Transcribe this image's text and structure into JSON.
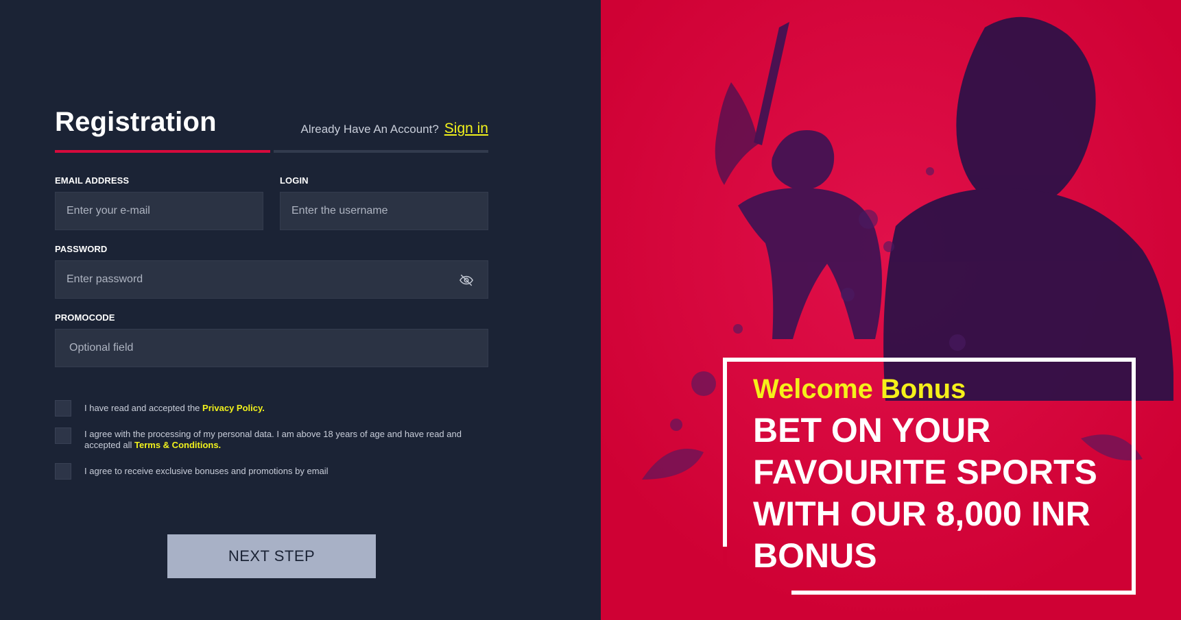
{
  "registration": {
    "title": "Registration",
    "already_text": "Already Have An Account?",
    "sign_in_label": "Sign in"
  },
  "form": {
    "email": {
      "label": "EMAIL ADDRESS",
      "placeholder": "Enter your e-mail"
    },
    "login": {
      "label": "LOGIN",
      "placeholder": "Enter the username"
    },
    "password": {
      "label": "PASSWORD",
      "placeholder": "Enter password"
    },
    "promocode": {
      "label": "PROMOCODE",
      "placeholder": "Optional field"
    }
  },
  "checkboxes": [
    {
      "text": "I have read and accepted the",
      "link": "Privacy Policy."
    },
    {
      "text": "I agree with the processing of my personal data. I am above 18 years of age and have read and accepted all",
      "link": "Terms & Conditions."
    },
    {
      "text": "I agree to receive exclusive bonuses and promotions by email",
      "link": ""
    }
  ],
  "next_button": "NEXT STEP",
  "banner": {
    "welcome": "Welcome Bonus",
    "headline": "BET ON YOUR FAVOURITE SPORTS WITH OUR 8,000 INR BONUS"
  },
  "colors": {
    "left_bg": "#1b2335",
    "right_bg": "#cf0134",
    "accent_yellow": "#f2f21c",
    "accent_red": "#d60a3d",
    "field_bg": "#2b3344",
    "button_bg": "#a8b1c6"
  },
  "icons": {
    "password_toggle": "eye-off-icon"
  }
}
